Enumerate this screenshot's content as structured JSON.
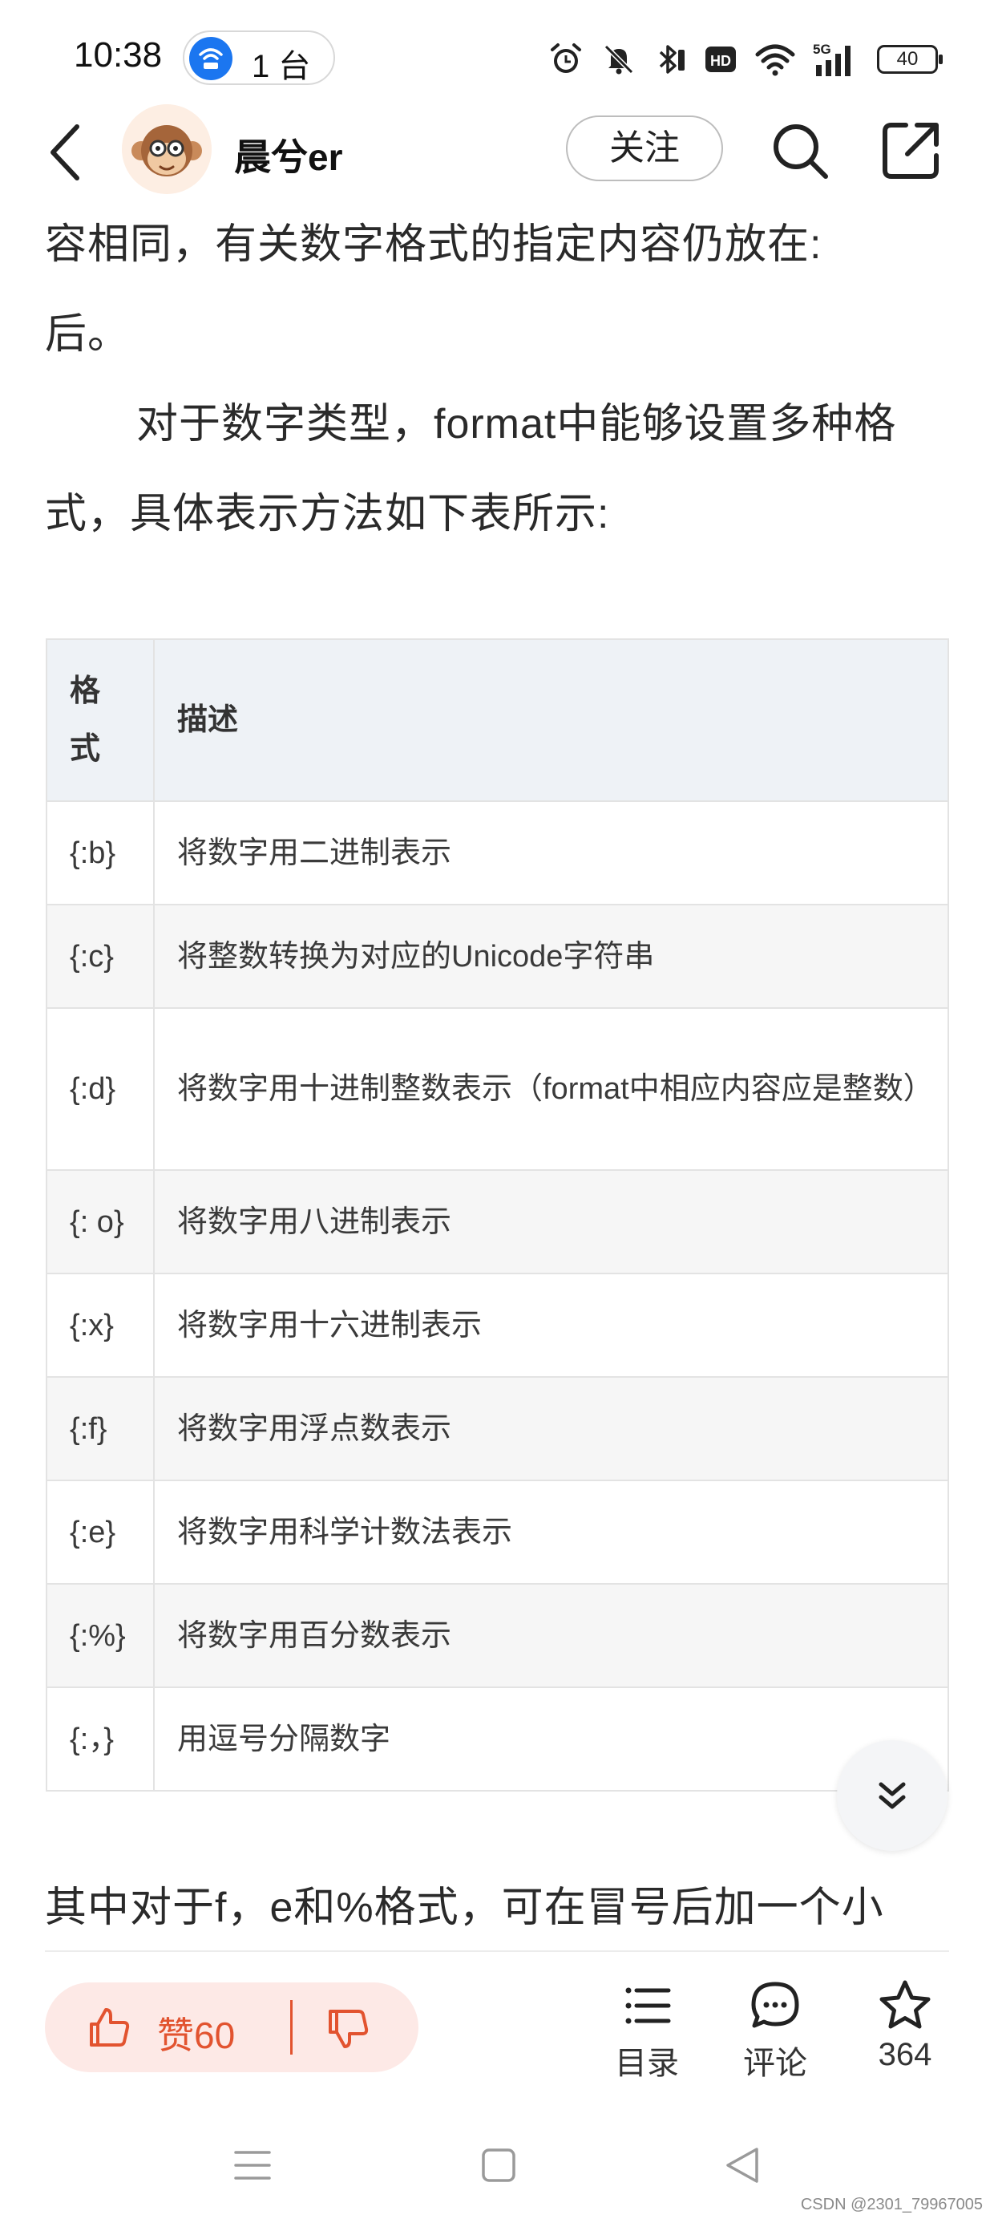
{
  "status_bar": {
    "time": "10:38",
    "hotspot_count": "1 台",
    "battery": "40",
    "network": "5G",
    "icons": [
      "alarm-icon",
      "mute-bell-icon",
      "bluetooth-icon",
      "hd-icon",
      "wifi-icon",
      "signal-icon",
      "battery-icon"
    ]
  },
  "header": {
    "author": "晨兮er",
    "follow_label": "关注"
  },
  "article": {
    "line1": "容相同，有关数字格式的指定内容仍放在:",
    "line2": "后。",
    "line3": "对于数字类型，format中能够设置多种格",
    "line4": "式，具体表示方法如下表所示:",
    "line5": "其中对于f，e和%格式，可在冒号后加一个小"
  },
  "table": {
    "headers": [
      "格式",
      "描述"
    ],
    "rows": [
      {
        "fmt": "{:b}",
        "desc": "将数字用二进制表示"
      },
      {
        "fmt": "{:c}",
        "desc": "将整数转换为对应的Unicode字符串"
      },
      {
        "fmt": "{:d}",
        "desc": "将数字用十进制整数表示（format中相应内容应是整数）"
      },
      {
        "fmt": "{: o}",
        "desc": "将数字用八进制表示"
      },
      {
        "fmt": "{:x}",
        "desc": "将数字用十六进制表示"
      },
      {
        "fmt": "{:f}",
        "desc": "将数字用浮点数表示"
      },
      {
        "fmt": "{:e}",
        "desc": "将数字用科学计数法表示"
      },
      {
        "fmt": "{:%}",
        "desc": "将数字用百分数表示"
      },
      {
        "fmt": "{:，}",
        "desc": "用逗号分隔数字"
      }
    ]
  },
  "bottom_bar": {
    "like_label": "赞60",
    "catalog_label": "目录",
    "comment_label": "评论",
    "favorite_count": "364"
  },
  "watermark": "CSDN @2301_79967005",
  "colors": {
    "accent": "#e2532f",
    "like_bg": "#fde9e6",
    "table_header_bg": "#eef2f6",
    "hotspot_blue": "#1b76f0"
  }
}
